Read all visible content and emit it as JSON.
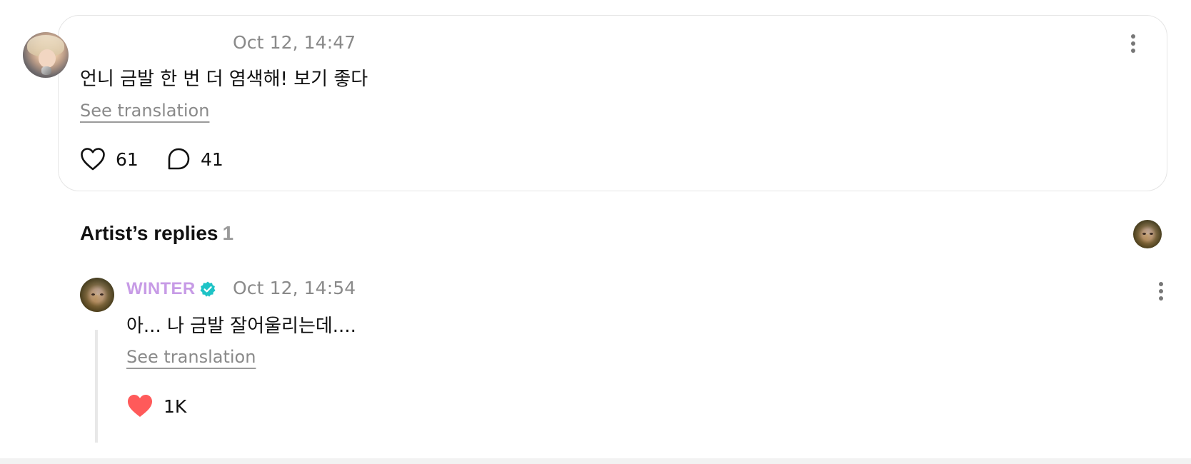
{
  "fan_comment": {
    "timestamp": "Oct 12, 14:47",
    "text": "언니 금발 한 번 더 염색해! 보기 좋다",
    "translate_label": "See translation",
    "likes": "61",
    "replies": "41",
    "icons": {
      "like": "heart-outline-icon",
      "reply": "speech-bubble-icon",
      "more": "vertical-dots-icon"
    }
  },
  "artist_replies": {
    "title": "Artist’s replies",
    "count": "1",
    "reply": {
      "author": "WINTER",
      "verified": true,
      "timestamp": "Oct 12, 14:54",
      "text": "아... 나 금발 잘어울리는데....",
      "translate_label": "See translation",
      "likes": "1K",
      "liked": true
    }
  },
  "colors": {
    "artist_name": "#c79be6",
    "verified_badge": "#1ec3c6",
    "liked_heart": "#ff5a5a",
    "muted_text": "#8a8a8a",
    "card_border": "#e5e5e5"
  }
}
